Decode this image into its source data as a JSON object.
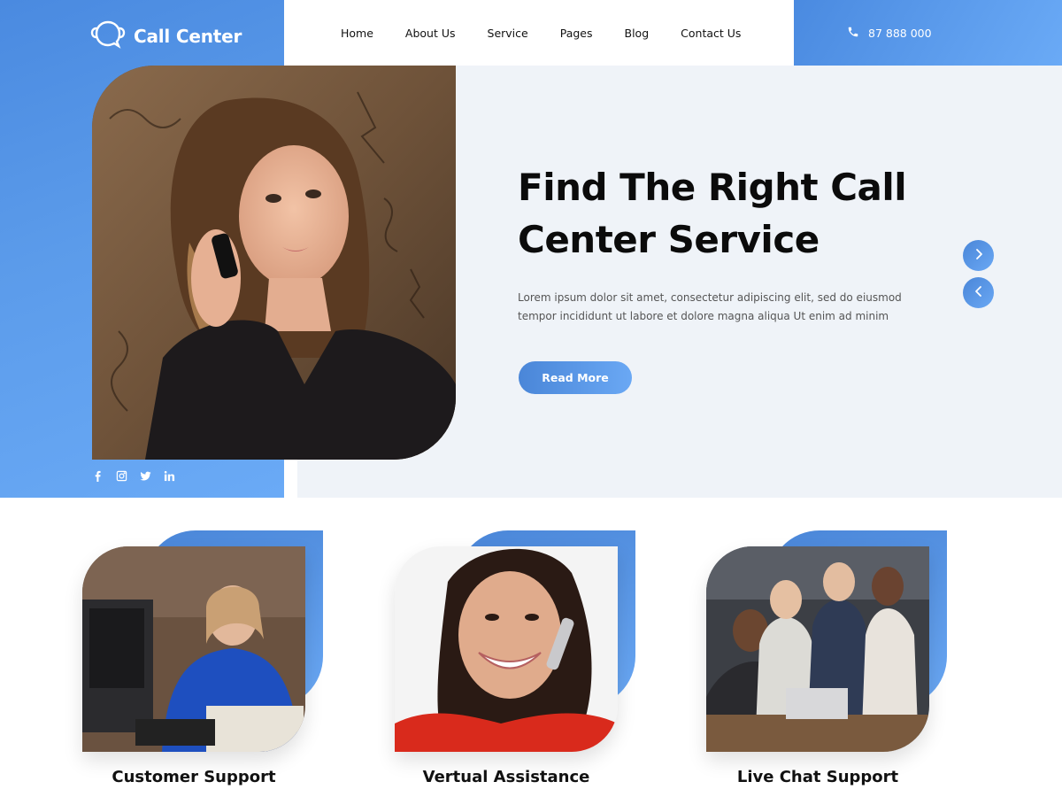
{
  "brand": {
    "name": "Call Center"
  },
  "nav": {
    "items": [
      {
        "label": "Home"
      },
      {
        "label": "About Us"
      },
      {
        "label": "Service"
      },
      {
        "label": "Pages"
      },
      {
        "label": "Blog"
      },
      {
        "label": "Contact Us"
      }
    ]
  },
  "contact": {
    "phone": "87 888 000",
    "icon": "phone-icon"
  },
  "hero": {
    "title_line1": "Find The Right Call",
    "title_line2": "Center Service",
    "description": "Lorem ipsum dolor sit amet, consectetur adipiscing elit, sed do eiusmod tempor incididunt ut labore et dolore magna aliqua Ut enim ad minim",
    "cta_label": "Read More",
    "next_icon": "chevron-right-icon",
    "prev_icon": "chevron-left-icon"
  },
  "socials": [
    "facebook-icon",
    "instagram-icon",
    "twitter-icon",
    "linkedin-icon"
  ],
  "services": [
    {
      "title": "Customer Support"
    },
    {
      "title": "Vertual Assistance"
    },
    {
      "title": "Live Chat Support"
    }
  ],
  "colors": {
    "accent": "#4a8ae0",
    "accent_light": "#6aaaf6",
    "hero_bg": "#eff3f8",
    "text_dark": "#0b0b0b"
  }
}
